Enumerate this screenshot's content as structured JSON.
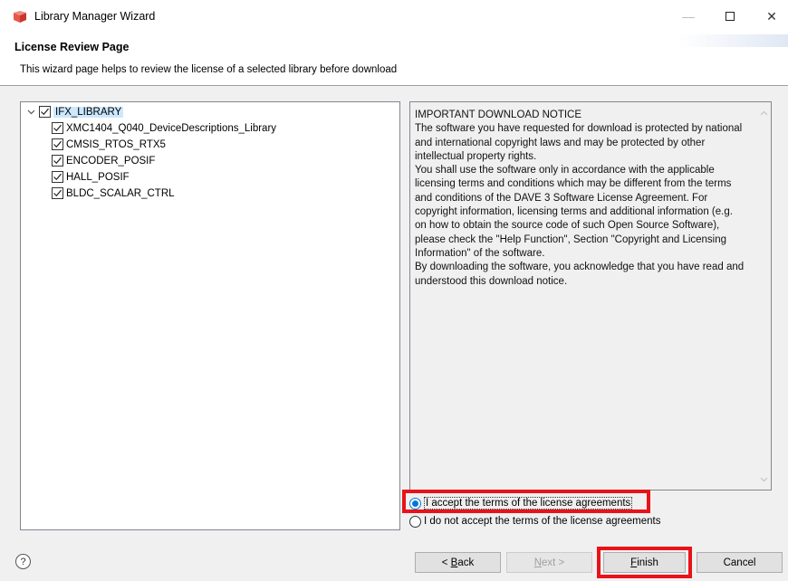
{
  "window": {
    "title": "Library Manager Wizard",
    "icon": "library-manager-app-icon",
    "minimize_glyph": "—",
    "close_glyph": "✕"
  },
  "header": {
    "title": "License Review Page",
    "description": "This wizard page helps to review the license of a selected library before download"
  },
  "tree": {
    "root": {
      "label": "IFX_LIBRARY",
      "checked": true,
      "expanded": true
    },
    "children": [
      {
        "label": "XMC1404_Q040_DeviceDescriptions_Library",
        "checked": true
      },
      {
        "label": "CMSIS_RTOS_RTX5",
        "checked": true
      },
      {
        "label": "ENCODER_POSIF",
        "checked": true
      },
      {
        "label": "HALL_POSIF",
        "checked": true
      },
      {
        "label": "BLDC_SCALAR_CTRL",
        "checked": true
      }
    ]
  },
  "license": {
    "lines": [
      "IMPORTANT DOWNLOAD NOTICE",
      "The software you have requested for download is protected by national",
      "and international copyright laws and may be protected by other",
      "intellectual property rights.",
      "You shall use the software only in accordance with the applicable",
      "licensing terms and conditions which may be different from the terms",
      "and conditions of the DAVE 3 Software License Agreement. For",
      "copyright information, licensing terms and additional information (e.g.",
      "on how to obtain the source code of such Open Source Software),",
      "please check the \"Help Function\", Section \"Copyright and Licensing",
      "Information\" of the software.",
      "By downloading the software, you acknowledge that you have read and",
      "understood this download notice."
    ]
  },
  "radios": {
    "accept": {
      "label": "I accept the terms of the license agreements",
      "selected": true
    },
    "decline": {
      "label": "I do not accept the terms of the license agreements",
      "selected": false
    }
  },
  "footer": {
    "help_glyph": "?",
    "back": {
      "prefix": "< ",
      "mnemonic": "B",
      "rest": "ack"
    },
    "next": {
      "mnemonic": "N",
      "rest": "ext >"
    },
    "finish": {
      "mnemonic": "F",
      "rest": "inish"
    },
    "cancel": "Cancel"
  },
  "colors": {
    "highlight": "#e8131a",
    "accent": "#0078d7"
  }
}
